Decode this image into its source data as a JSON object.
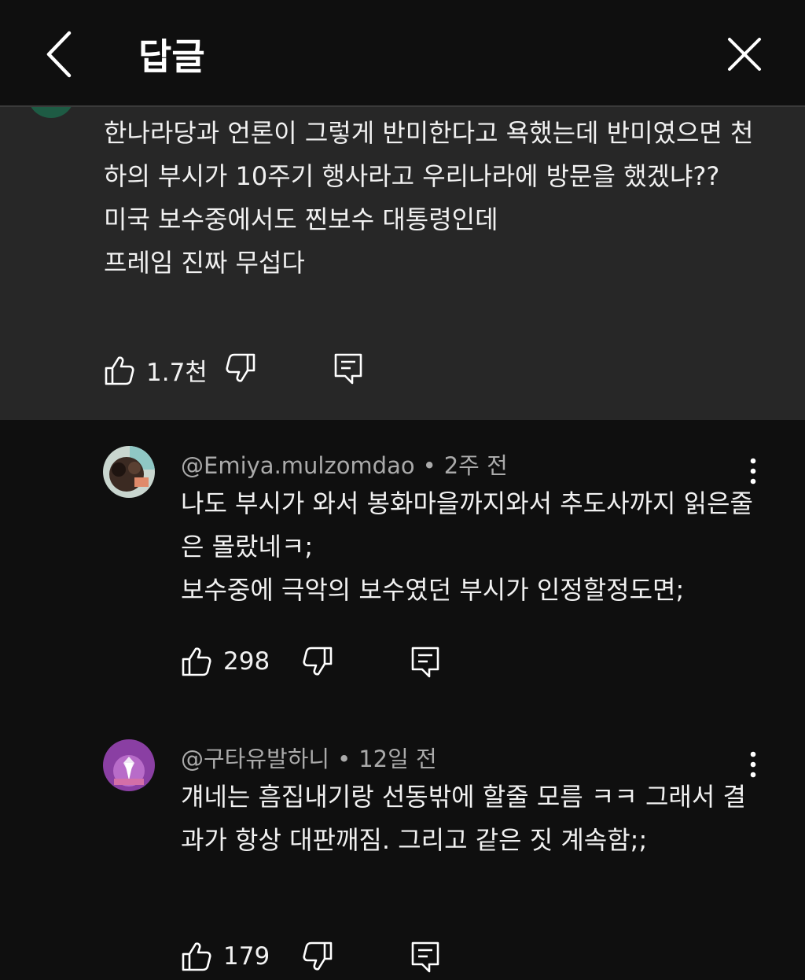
{
  "header": {
    "title": "답글"
  },
  "parent_comment": {
    "text": "한나라당과 언론이 그렇게 반미한다고 욕했는데 반미였으면 천하의 부시가 10주기 행사라고 우리나라에 방문을 했겠냐??\n미국 보수중에서도 찐보수 대통령인데\n프레임 진짜 무섭다",
    "likes": "1.7천"
  },
  "replies": [
    {
      "author": "@Emiya.mulzomdao",
      "time": "2주 전",
      "text": "나도 부시가 와서 봉화마을까지와서 추도사까지 읽은줄은 몰랐네ㅋ;\n보수중에 극악의 보수였던 부시가 인정할정도면;",
      "likes": "298"
    },
    {
      "author": "@구타유발하니",
      "time": "12일 전",
      "text": "걔네는 흠집내기랑 선동밖에 할줄 모름 ㅋㅋ 그래서 결과가 항상 대판깨짐. 그리고 같은 짓 계속함;;",
      "likes": "179"
    }
  ],
  "colors": {
    "background": "#0f0f0f",
    "parent_bg": "#272727",
    "meta_text": "#aaaaaa"
  },
  "icons": [
    "back-arrow-icon",
    "close-icon",
    "thumbs-up-icon",
    "thumbs-down-icon",
    "reply-icon",
    "more-vert-icon"
  ]
}
